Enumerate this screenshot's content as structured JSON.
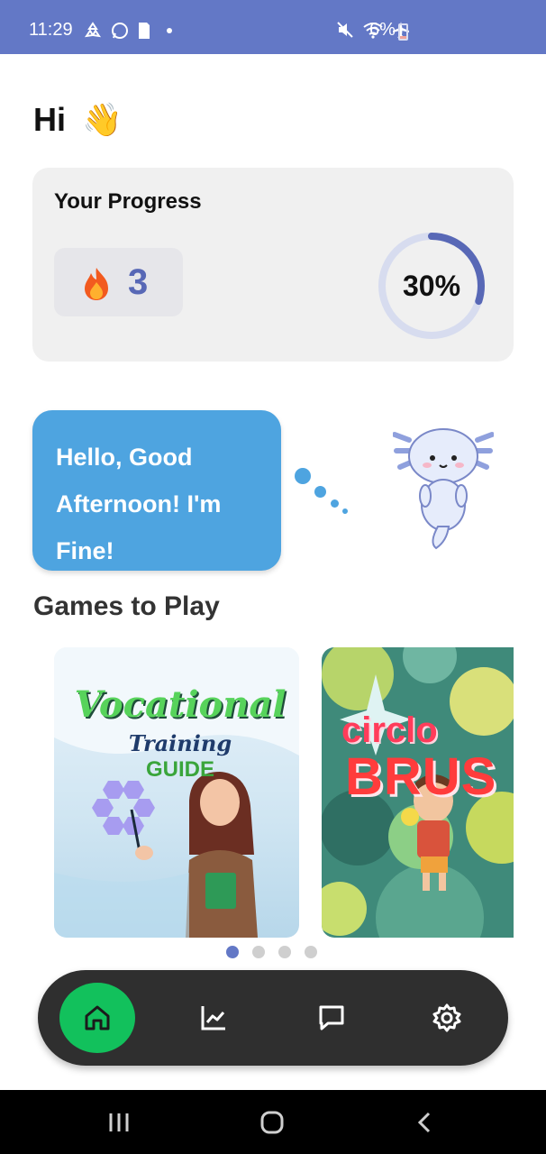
{
  "status_bar": {
    "time": "11:29",
    "battery_percent": "6%",
    "battery_level": 0.06
  },
  "greeting": {
    "text": "Hi",
    "emoji": "👋"
  },
  "progress": {
    "title": "Your Progress",
    "streak": "3",
    "percent_label": "30%",
    "percent_value": 0.3
  },
  "mascot_message": "Hello, Good Afternoon! I'm Fine!",
  "games": {
    "title": "Games to Play",
    "cards": [
      {
        "title_main": "Vocational",
        "title_sub": "Training",
        "title_guide": "GUIDE"
      },
      {
        "title_line1": "circlo",
        "title_line2": "BRUS"
      }
    ],
    "page_count": 4,
    "active_page": 0
  },
  "nav": {
    "items": [
      "home-icon",
      "chart-icon",
      "chat-icon",
      "gear-icon"
    ],
    "active": "home-icon"
  },
  "colors": {
    "status_bar": "#6378c6",
    "accent": "#5868b6",
    "home_active": "#12c15c",
    "speech": "#4ea4e0",
    "nav_bg": "#2f2f2f"
  }
}
